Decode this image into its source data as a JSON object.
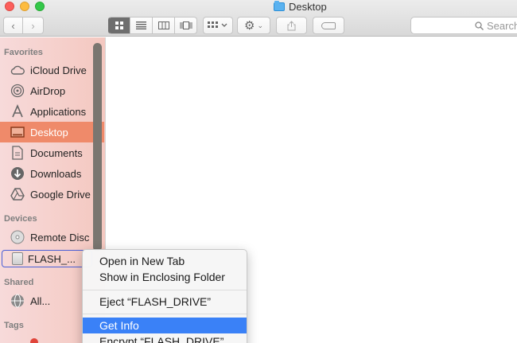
{
  "window": {
    "title": "Desktop",
    "search_placeholder": "Search"
  },
  "toolbar": {
    "back_icon": "chevron-left-icon",
    "forward_icon": "chevron-right-icon",
    "view_modes": [
      "icon-view",
      "list-view",
      "column-view",
      "cover-flow-view"
    ],
    "arrange_icon": "arrange-icon",
    "action_icon": "gear-icon",
    "share_icon": "share-icon",
    "tag_icon": "tag-icon"
  },
  "sidebar": {
    "favorites_heading": "Favorites",
    "favorites": [
      {
        "label": "iCloud Drive",
        "icon": "cloud-icon"
      },
      {
        "label": "AirDrop",
        "icon": "airdrop-icon"
      },
      {
        "label": "Applications",
        "icon": "applications-icon"
      },
      {
        "label": "Desktop",
        "icon": "desktop-icon",
        "selected": true
      },
      {
        "label": "Documents",
        "icon": "document-icon"
      },
      {
        "label": "Downloads",
        "icon": "download-icon"
      },
      {
        "label": "Google Drive",
        "icon": "google-drive-icon"
      }
    ],
    "devices_heading": "Devices",
    "devices": [
      {
        "label": "Remote Disc",
        "icon": "disc-icon"
      },
      {
        "label": "FLASH_...",
        "icon": "drive-icon"
      }
    ],
    "shared_heading": "Shared",
    "shared": [
      {
        "label": "All...",
        "icon": "globe-icon"
      }
    ],
    "tags_heading": "Tags"
  },
  "context_menu": {
    "items": [
      "Open in New Tab",
      "Show in Enclosing Folder",
      "Eject “FLASH_DRIVE”",
      "Get Info",
      "Encrypt “FLASH_DRIVE”"
    ],
    "highlighted": "Get Info"
  },
  "colors": {
    "selection": "#ef8a6a",
    "menu_highlight": "#3a81f7"
  }
}
